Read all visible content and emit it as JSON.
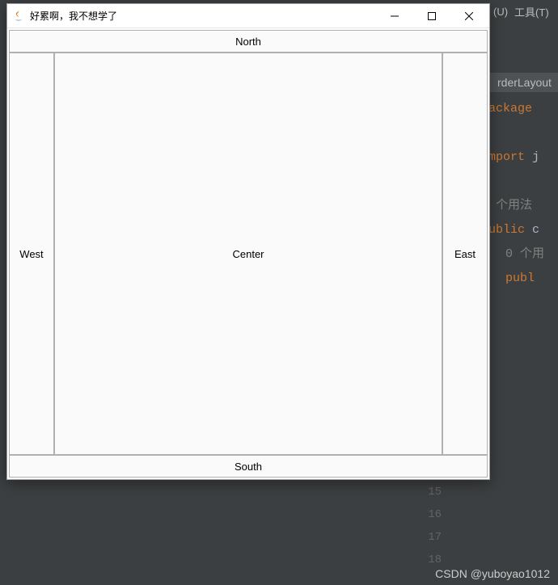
{
  "ide": {
    "menu_item_1": "(U)",
    "menu_item_2": "工具(T)",
    "tab_file": "rderLayout",
    "code": {
      "l1_kw": "package",
      "l2_kw": "import",
      "l2_rest": " j",
      "l3_usage": ") 个用法",
      "l4_kw": "public",
      "l4_rest": " c",
      "l5_usage": "0 个用",
      "l6_kw": "publ"
    },
    "gutter": [
      "15",
      "16",
      "17",
      "18"
    ]
  },
  "dialog": {
    "title": "好累啊，我不想学了",
    "buttons": {
      "north": "North",
      "south": "South",
      "west": "West",
      "east": "East",
      "center": "Center"
    }
  },
  "watermark": "CSDN @yuboyao1012"
}
